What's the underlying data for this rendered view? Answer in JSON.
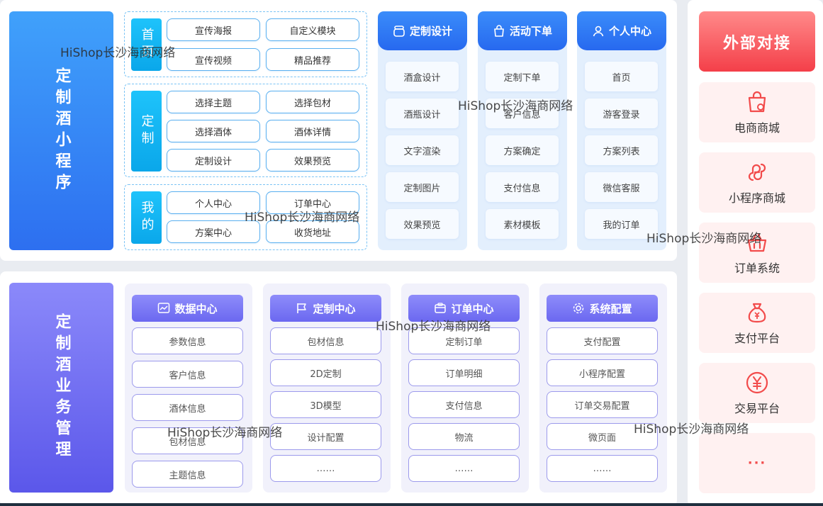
{
  "top_title": "定制酒小程序",
  "bottom_title": "定制酒业务管理",
  "mini_groups": [
    {
      "label": "首页",
      "items": [
        "宣传海报",
        "自定义模块",
        "宣传视频",
        "精品推荐"
      ]
    },
    {
      "label": "定制",
      "items": [
        "选择主题",
        "选择包材",
        "选择酒体",
        "酒体详情",
        "定制设计",
        "效果预览"
      ]
    },
    {
      "label": "我的",
      "items": [
        "个人中心",
        "订单中心",
        "方案中心",
        "收货地址"
      ]
    }
  ],
  "feature_columns": [
    {
      "title": "定制设计",
      "icon": "bottle-icon",
      "items": [
        "酒盒设计",
        "酒瓶设计",
        "文字渲染",
        "定制图片",
        "效果预览"
      ]
    },
    {
      "title": "活动下单",
      "icon": "shopping-bag-icon",
      "items": [
        "定制下单",
        "客户信息",
        "方案确定",
        "支付信息",
        "素材模板"
      ]
    },
    {
      "title": "个人中心",
      "icon": "user-icon",
      "items": [
        "首页",
        "游客登录",
        "方案列表",
        "微信客服",
        "我的订单"
      ]
    }
  ],
  "management_columns": [
    {
      "title": "数据中心",
      "icon": "chart-icon",
      "items": [
        "参数信息",
        "客户信息",
        "酒体信息",
        "包材信息",
        "主题信息"
      ]
    },
    {
      "title": "定制中心",
      "icon": "flag-icon",
      "items": [
        "包材信息",
        "2D定制",
        "3D模型",
        "设计配置",
        "……"
      ]
    },
    {
      "title": "订单中心",
      "icon": "wallet-icon",
      "items": [
        "定制订单",
        "订单明细",
        "支付信息",
        "物流",
        "……"
      ]
    },
    {
      "title": "系统配置",
      "icon": "gear-icon",
      "items": [
        "支付配置",
        "小程序配置",
        "订单交易配置",
        "微页面",
        "……"
      ]
    }
  ],
  "external": {
    "title": "外部对接",
    "items": [
      {
        "label": "电商商城",
        "icon": "shop-bag-icon"
      },
      {
        "label": "小程序商城",
        "icon": "mini-program-icon"
      },
      {
        "label": "订单系统",
        "icon": "basket-icon"
      },
      {
        "label": "支付平台",
        "icon": "money-bag-icon"
      },
      {
        "label": "交易平台",
        "icon": "yen-circle-icon"
      }
    ],
    "more": "···"
  },
  "watermark": "HiShop长沙海商网络",
  "colors": {
    "blue_accent": "#2d6ff0",
    "cyan_accent": "#0aa7ea",
    "purple_accent": "#6b68f0",
    "red_accent": "#f43f49"
  }
}
